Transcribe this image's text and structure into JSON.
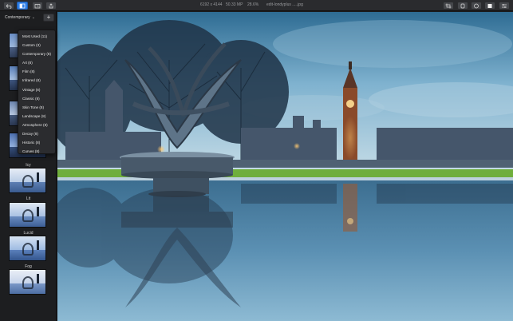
{
  "toolbar": {
    "buttons": [
      "undo",
      "compare",
      "history",
      "share"
    ],
    "image_size": "6192 x 4144",
    "megapixels": "50.33 MP",
    "zoom": "28.6%",
    "filename": "edit-londyplus .....jpg",
    "right_buttons": [
      "crop",
      "retouch",
      "mask",
      "presets",
      "export"
    ]
  },
  "sidebar": {
    "category": "Contemporary",
    "add_label": "+",
    "thumbnails": [
      {
        "label": "Icy"
      },
      {
        "label": "Lit"
      },
      {
        "label": "Lucid"
      },
      {
        "label": "Fog"
      }
    ]
  },
  "menu": {
    "items": [
      "Most Used (11)",
      "Custom (3)",
      "Contemporary (8)",
      "Art (8)",
      "Film (8)",
      "Infrared (8)",
      "Vintage (8)",
      "Classic (8)",
      "Skin Tone (8)",
      "Landscape (8)",
      "Atmosphere (8)",
      "Decay (8)",
      "Historic (8)",
      "Curves (8)"
    ]
  },
  "colors": {
    "accent": "#2f7fe6",
    "toolbar_bg": "#2a2b2e",
    "sidebar_bg": "#1d1e20"
  }
}
